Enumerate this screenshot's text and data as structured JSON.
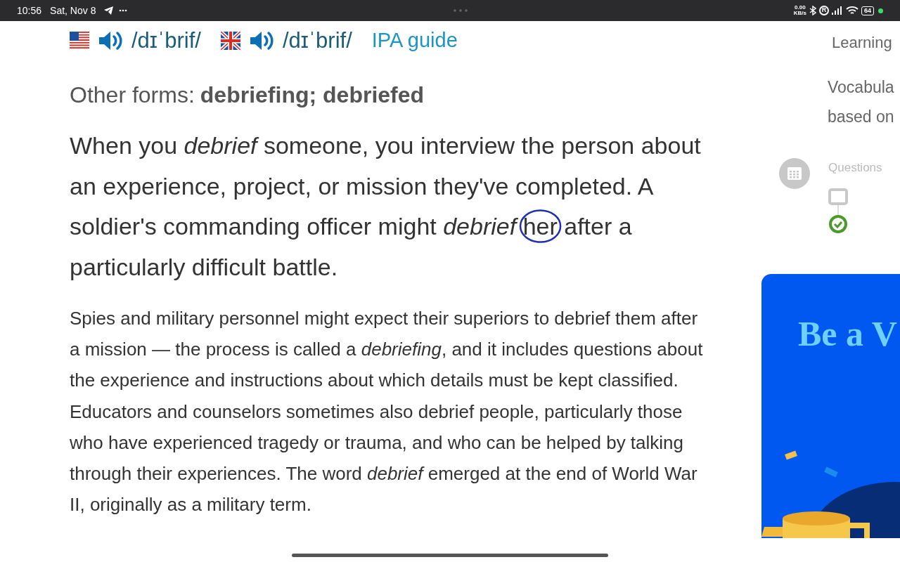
{
  "status_bar": {
    "time": "10:56",
    "date": "Sat, Nov 8",
    "net_speed": "0.00",
    "net_unit": "KB/s",
    "ring_mode": "R",
    "battery": "64",
    "charging_dot": true
  },
  "pronunciation": [
    {
      "kind": "us",
      "ipa": "/dɪˈbrif/"
    },
    {
      "kind": "uk",
      "ipa": "/dɪˈbrif/"
    }
  ],
  "ipa_link": "IPA guide",
  "other_forms": {
    "label": "Other forms:",
    "forms": "debriefing; debriefed"
  },
  "short_definition": {
    "before": "When you *debrief* someone, you interview the person about an experience, project, or mission they've completed. A soldier's commanding officer might *debrief*",
    "circled_word": "her",
    "after": "after a particularly difficult battle."
  },
  "long_definition": "Spies and military personnel might expect their superiors to debrief them after a mission — the process is called a *debriefing*, and it includes questions about the experience and instructions about which details must be kept classified. Educators and counselors sometimes also debrief people, particularly those who have experienced tragedy or trauma, and who can be helped by talking through their experiences. The word *debrief* emerged at the end of World War II, originally as a military term.",
  "sidebar": {
    "heading": "Learning",
    "intro": [
      "Vocabula",
      "based on"
    ],
    "questions_label": "Questions",
    "steps": [
      {
        "done": false
      },
      {
        "done": true
      }
    ],
    "promo": {
      "title": "Be a V"
    }
  }
}
